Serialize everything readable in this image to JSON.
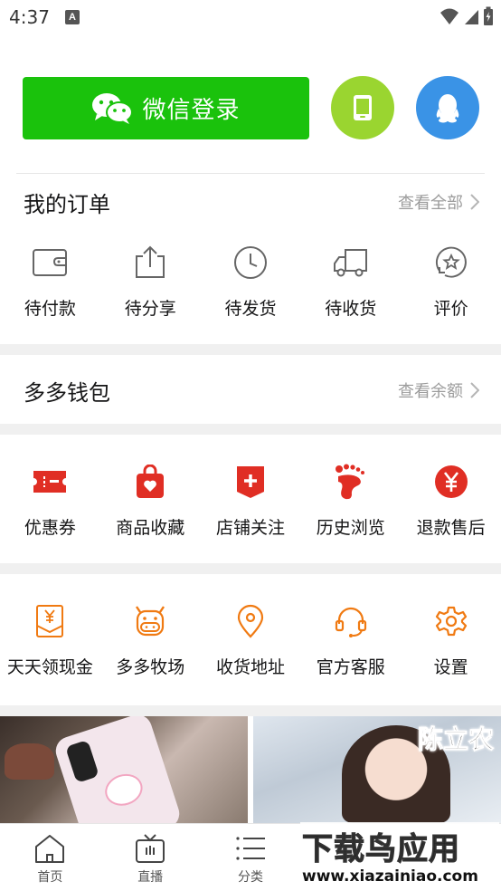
{
  "status_bar": {
    "time": "4:37",
    "notification_icon": "A"
  },
  "login": {
    "wechat_label": "微信登录",
    "icons": {
      "wechat": "wechat-icon",
      "phone": "phone-icon",
      "qq": "qq-icon"
    },
    "colors": {
      "wechat": "#1ac20c",
      "phone": "#9ad530",
      "qq": "#3a93e6"
    }
  },
  "orders": {
    "title": "我的订单",
    "view_all": "查看全部",
    "items": [
      {
        "label": "待付款",
        "icon": "wallet-icon"
      },
      {
        "label": "待分享",
        "icon": "share-icon"
      },
      {
        "label": "待发货",
        "icon": "clock-icon"
      },
      {
        "label": "待收货",
        "icon": "truck-icon"
      },
      {
        "label": "评价",
        "icon": "review-icon"
      }
    ]
  },
  "wallet": {
    "title": "多多钱包",
    "view_balance": "查看余额"
  },
  "tools1": {
    "accent_color": "#e02e24",
    "items": [
      {
        "label": "优惠券",
        "icon": "coupon-icon"
      },
      {
        "label": "商品收藏",
        "icon": "bag-heart-icon"
      },
      {
        "label": "店铺关注",
        "icon": "shop-follow-icon"
      },
      {
        "label": "历史浏览",
        "icon": "footprint-icon"
      },
      {
        "label": "退款售后",
        "icon": "refund-icon"
      }
    ]
  },
  "tools2": {
    "accent_color": "#f07a12",
    "items": [
      {
        "label": "天天领现金",
        "icon": "cash-envelope-icon"
      },
      {
        "label": "多多牧场",
        "icon": "cow-icon"
      },
      {
        "label": "收货地址",
        "icon": "location-icon"
      },
      {
        "label": "官方客服",
        "icon": "headset-icon"
      },
      {
        "label": "设置",
        "icon": "gear-icon"
      }
    ]
  },
  "feed": {
    "right_card_label": "陈立农"
  },
  "tabbar": {
    "items": [
      {
        "label": "首页",
        "icon": "home-icon"
      },
      {
        "label": "直播",
        "icon": "tv-icon"
      },
      {
        "label": "分类",
        "icon": "list-icon"
      }
    ]
  },
  "watermark": {
    "title": "下载鸟应用",
    "url": "www.xiazainiao.com"
  }
}
